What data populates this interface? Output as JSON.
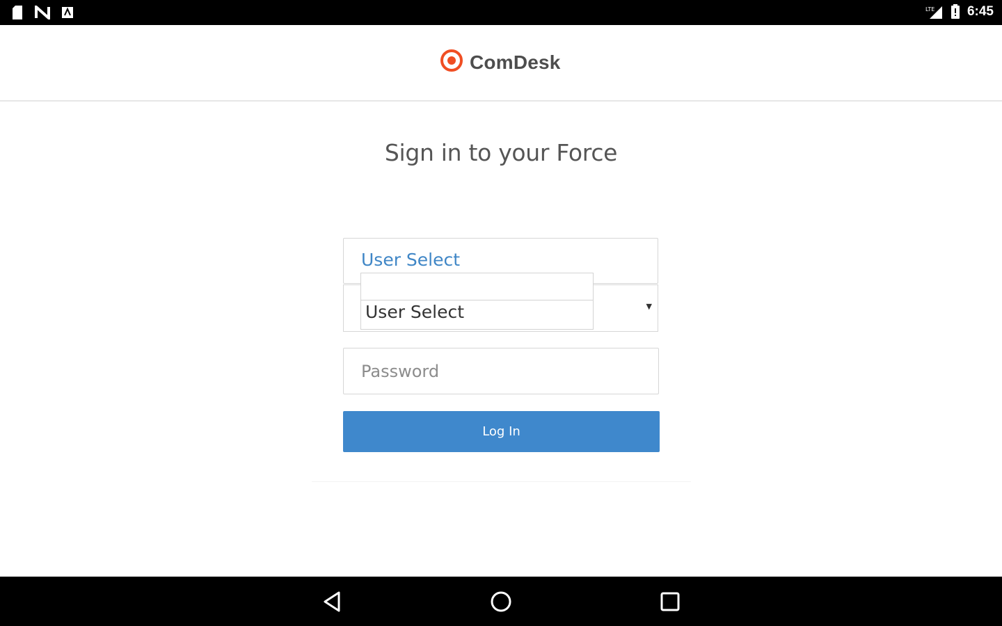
{
  "status_bar": {
    "time": "6:45",
    "left_icons": [
      "sd-card-icon",
      "nfc-icon",
      "app-notification-icon"
    ],
    "right_icons": [
      "signal-icon",
      "battery-icon"
    ]
  },
  "header": {
    "logo_text": "ComDesk",
    "logo_icon": "comdesk-logo-icon",
    "accent_color": "#f04e23"
  },
  "page": {
    "title": "Sign in to your Force"
  },
  "form": {
    "user_select_label": "User Select",
    "user_select_dropdown": {
      "options": [
        "",
        "User Select"
      ]
    },
    "password_placeholder": "Password",
    "login_label": "Log In",
    "button_color": "#3f88cc"
  },
  "nav_bar": {
    "buttons": [
      "back-icon",
      "home-icon",
      "recents-icon"
    ]
  }
}
